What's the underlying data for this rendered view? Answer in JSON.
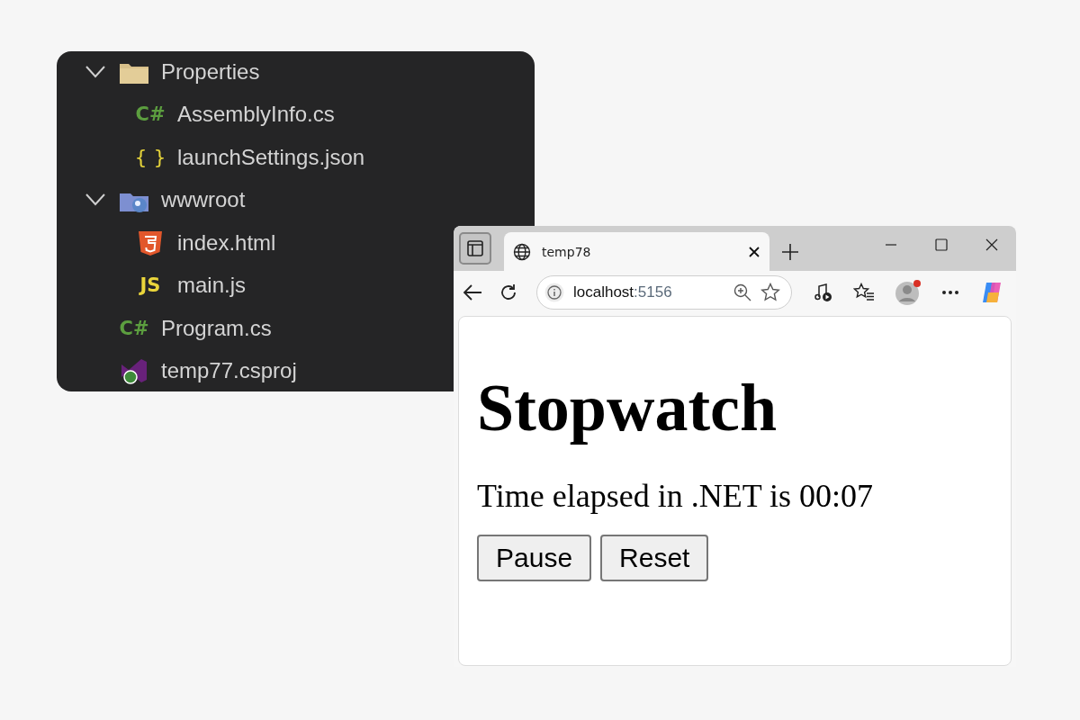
{
  "explorer": {
    "items": [
      {
        "label": "Properties",
        "kind": "folder",
        "expanded": true,
        "children": [
          {
            "label": "AssemblyInfo.cs",
            "kind": "csharp",
            "icon_text": "C#"
          },
          {
            "label": "launchSettings.json",
            "kind": "json",
            "icon_text": "{ }"
          }
        ]
      },
      {
        "label": "wwwroot",
        "kind": "webfolder",
        "expanded": true,
        "children": [
          {
            "label": "index.html",
            "kind": "html"
          },
          {
            "label": "main.js",
            "kind": "js",
            "icon_text": "JS"
          }
        ]
      },
      {
        "label": "Program.cs",
        "kind": "csharp",
        "icon_text": "C#"
      },
      {
        "label": "temp77.csproj",
        "kind": "csproj"
      }
    ]
  },
  "browser": {
    "tabs": [
      {
        "title": "temp78",
        "selected": true
      }
    ],
    "address": {
      "host": "localhost",
      "port": ":5156"
    },
    "page": {
      "heading": "Stopwatch",
      "text": "Time elapsed in .NET is 00:07",
      "buttons": [
        "Pause",
        "Reset"
      ]
    }
  }
}
